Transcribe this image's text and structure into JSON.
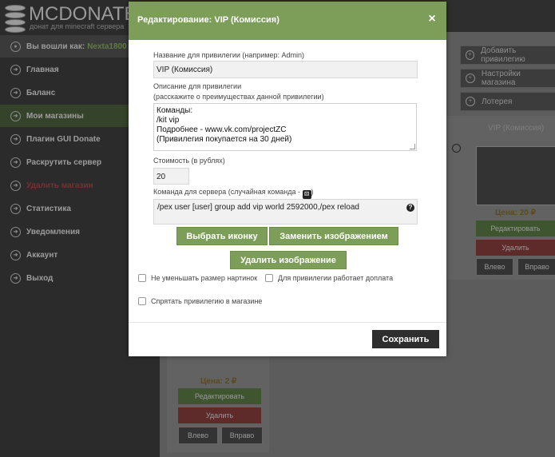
{
  "app": {
    "logo_text": "MCDONATE",
    "logo_sub": "донат для minecraft сервера"
  },
  "sidebar": {
    "user_label": "Вы вошли как:",
    "user_nick": "Nexta1800",
    "items": [
      {
        "label": "Главная"
      },
      {
        "label": "Баланс"
      },
      {
        "label": "Мои магазины"
      },
      {
        "label": "Плагин GUI Donate"
      },
      {
        "label": "Раскрутить сервер"
      },
      {
        "label": "Удалить магазин"
      },
      {
        "label": "Статистика"
      },
      {
        "label": "Уведомления"
      },
      {
        "label": "Аккаунт"
      },
      {
        "label": "Выход"
      }
    ]
  },
  "background": {
    "right_buttons": [
      "Добавить привилегию",
      "Настройки магазина",
      "Лотерея"
    ],
    "card_right": {
      "title": "VIP (Комиссия)",
      "price": "Цена: 20 ₽",
      "edit": "Редактировать",
      "delete": "Удалить",
      "left": "Влево",
      "right": "Вправо"
    },
    "card_bottom": {
      "price": "Цена: 2 ₽",
      "edit": "Редактировать",
      "delete": "Удалить",
      "left": "Влево",
      "right": "Вправо"
    }
  },
  "modal": {
    "title": "Редактирование: VIP (Комиссия)",
    "close_icon": "×",
    "name_label": "Название для привилегии (например: Admin)",
    "name_value": "VIP (Комиссия)",
    "desc_label_1": "Описание для привилегии",
    "desc_label_2": "(расскажите о преимуществах данной привилегии)",
    "desc_lines": [
      "Команды:",
      "/kit vip",
      "Подробнее - www.vk.com/projectZC",
      "(Привилегия покупается на 30 дней)"
    ],
    "cost_label": "Стоимость (в рублях)",
    "cost_value": "20",
    "cmd_label": "Команда для сервера (случайная команда - ",
    "cmd_label_end": ")",
    "cmd_value": "/pex user [user] group add vip world 2592000,/pex reload",
    "btn_choose_icon": "Выбрать иконку",
    "btn_replace_image": "Заменить изображением",
    "btn_delete_image": "Удалить изображение",
    "chk_no_resize": "Не уменьшать размер нартинок",
    "chk_surcharge": "Для привилегии работает доплата",
    "chk_hide": "Спрятать привилегию в магазине",
    "save": "Сохранить"
  },
  "colors": {
    "accent_green": "#7c9e58",
    "dark_button": "#2e2e2e"
  }
}
